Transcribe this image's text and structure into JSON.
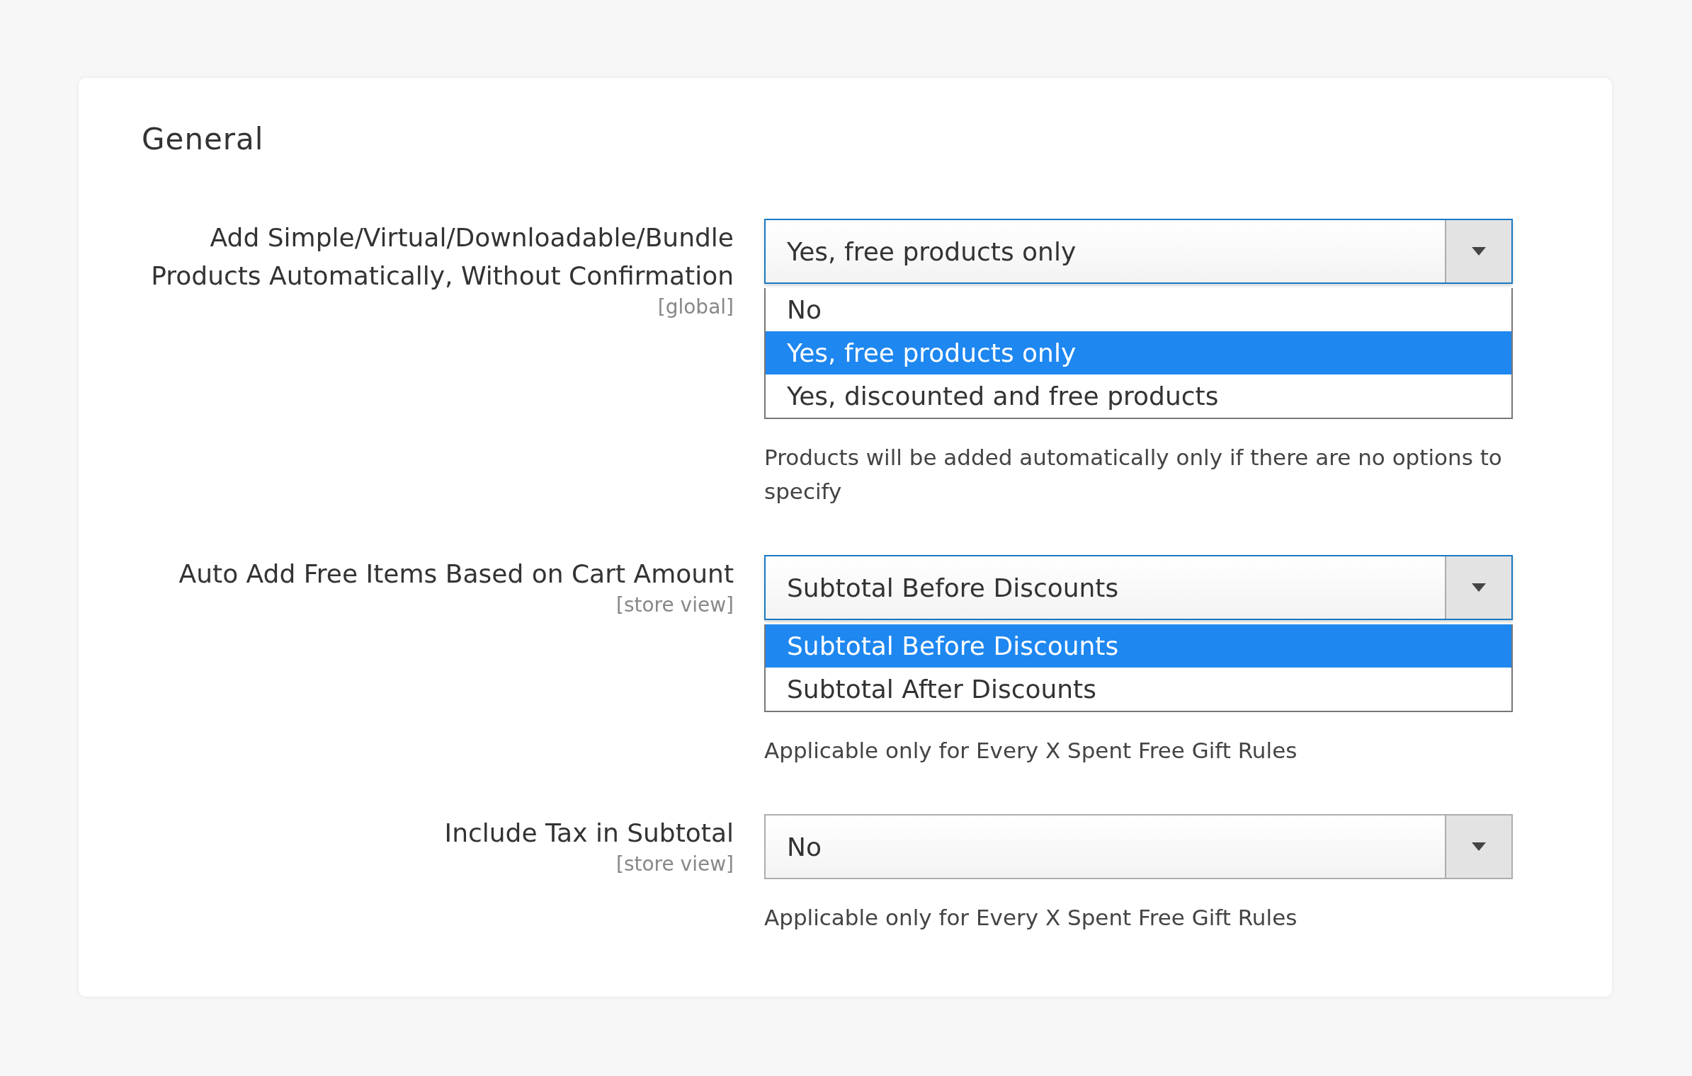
{
  "section": {
    "title": "General"
  },
  "fields": [
    {
      "label": "Add Simple/Virtual/Downloadable/Bundle Products Automatically, Without Confirmation",
      "scope": "[global]",
      "value": "Yes, free products only",
      "expanded": true,
      "options": [
        {
          "label": "No",
          "selected": false
        },
        {
          "label": "Yes, free products only",
          "selected": true
        },
        {
          "label": "Yes, discounted and free products",
          "selected": false
        }
      ],
      "note": "Products will be added automatically only if there are no options to specify"
    },
    {
      "label": "Auto Add Free Items Based on Cart Amount",
      "scope": "[store view]",
      "value": "Subtotal Before Discounts",
      "expanded": true,
      "options": [
        {
          "label": "Subtotal Before Discounts",
          "selected": true
        },
        {
          "label": "Subtotal After Discounts",
          "selected": false
        }
      ],
      "note": "Applicable only for Every X Spent Free Gift Rules"
    },
    {
      "label": "Include Tax in Subtotal",
      "scope": "[store view]",
      "value": "No",
      "expanded": false,
      "note": "Applicable only for Every X Spent Free Gift Rules"
    }
  ]
}
